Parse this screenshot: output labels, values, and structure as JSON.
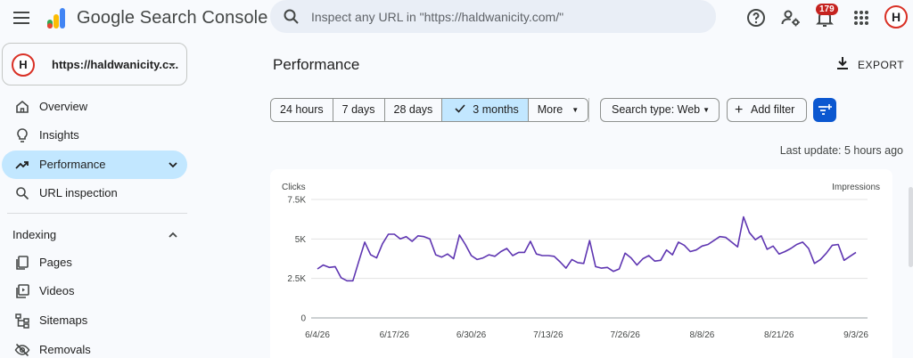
{
  "app": {
    "title": "Google Search Console",
    "notification_count": "179",
    "avatar_letter": "H"
  },
  "search": {
    "placeholder": "Inspect any URL in \"https://haldwanicity.com/\""
  },
  "property": {
    "name": "https://haldwanicity.c...",
    "avatar_letter": "H"
  },
  "sidebar": {
    "items": [
      {
        "label": "Overview",
        "icon": "home-icon"
      },
      {
        "label": "Insights",
        "icon": "lightbulb-icon"
      },
      {
        "label": "Performance",
        "icon": "trending-up-icon",
        "active": true
      },
      {
        "label": "URL inspection",
        "icon": "search-icon"
      }
    ],
    "indexing": {
      "label": "Indexing",
      "items": [
        {
          "label": "Pages",
          "icon": "pages-icon"
        },
        {
          "label": "Videos",
          "icon": "video-icon"
        },
        {
          "label": "Sitemaps",
          "icon": "sitemap-icon"
        },
        {
          "label": "Removals",
          "icon": "eye-off-icon"
        }
      ]
    }
  },
  "main": {
    "title": "Performance",
    "export_label": "EXPORT",
    "ranges": [
      "24 hours",
      "7 days",
      "28 days",
      "3 months",
      "More"
    ],
    "selected_range": "3 months",
    "search_type": "Search type: Web",
    "add_filter": "Add filter",
    "last_update": "Last update: 5 hours ago"
  },
  "colors": {
    "accent": "#0b57d0",
    "selected": "#c2e7ff",
    "series": "#5e35b1"
  },
  "chart_data": {
    "type": "line",
    "ylabel": "Clicks",
    "y2label": "Impressions",
    "ylim": [
      0,
      7500
    ],
    "yticks": [
      "0",
      "2.5K",
      "5K",
      "7.5K"
    ],
    "x_ticks": [
      "6/4/26",
      "6/17/26",
      "6/30/26",
      "7/13/26",
      "7/26/26",
      "8/8/26",
      "8/21/26",
      "9/3/26"
    ],
    "grid": true,
    "series": [
      {
        "values": [
          3100,
          3350,
          3200,
          3250,
          2550,
          2350,
          2350,
          3600,
          4800,
          4000,
          3800,
          4700,
          5300,
          5300,
          5000,
          5150,
          4850,
          5200,
          5150,
          5000,
          4000,
          3850,
          4050,
          3750,
          5250,
          4650,
          3950,
          3700,
          3800,
          4000,
          3900,
          4200,
          4400,
          3950,
          4150,
          4150,
          4850,
          4050,
          3950,
          3950,
          3900,
          3550,
          3150,
          3700,
          3500,
          3450,
          4900,
          3250,
          3150,
          3200,
          2950,
          3100,
          4100,
          3800,
          3350,
          3750,
          3950,
          3600,
          3650,
          4300,
          4000,
          4800,
          4600,
          4200,
          4300,
          4550,
          4650,
          4900,
          5150,
          5100,
          4800,
          4500,
          6400,
          5400,
          4950,
          5200,
          4350,
          4550,
          4050,
          4200,
          4400,
          4650,
          4800,
          4400,
          3450,
          3700,
          4100,
          4600,
          4650,
          3650,
          3900,
          4150
        ]
      }
    ]
  }
}
